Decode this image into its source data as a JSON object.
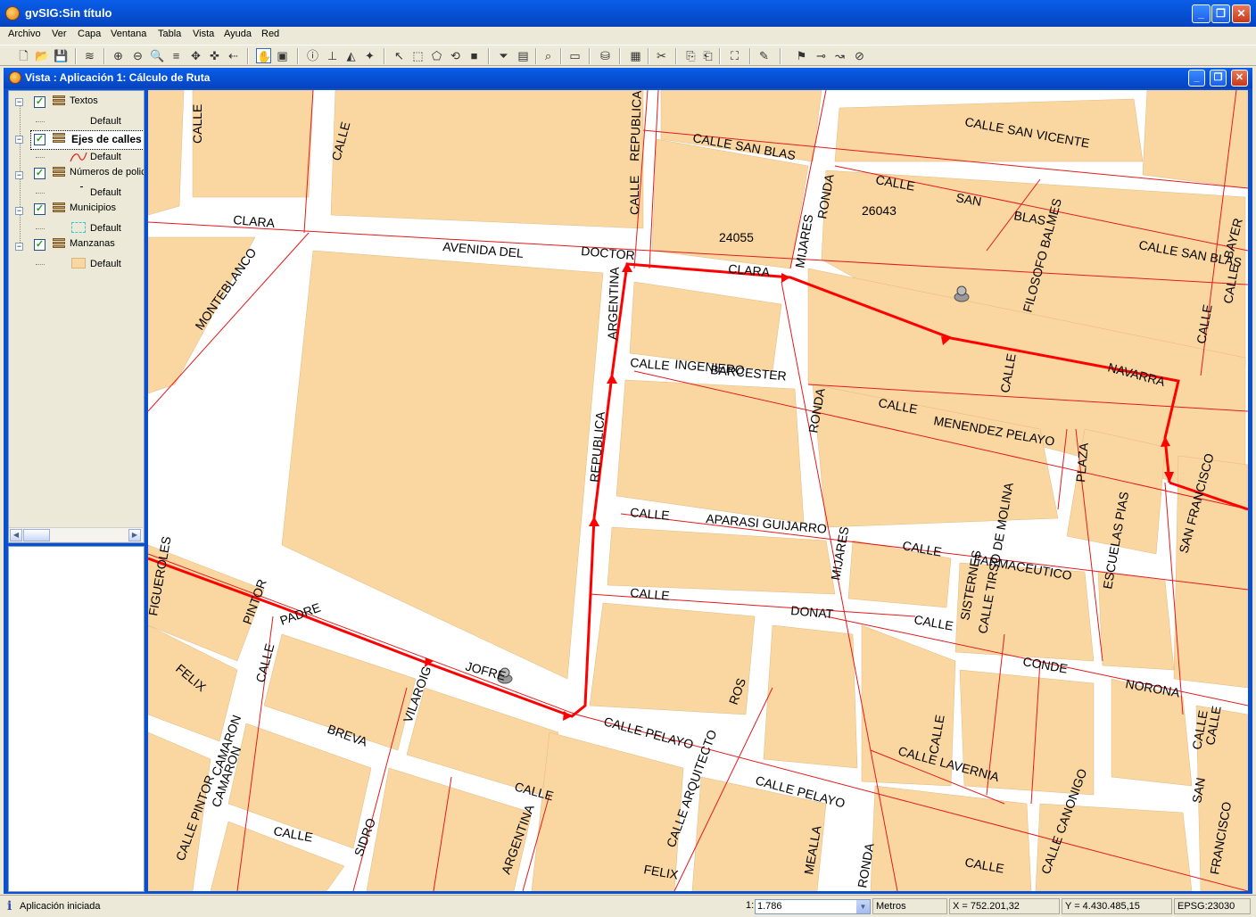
{
  "window": {
    "title": "gvSIG:Sin título"
  },
  "menu": [
    "Archivo",
    "Ver",
    "Capa",
    "Ventana",
    "Tabla",
    "Vista",
    "Ayuda",
    "Red"
  ],
  "view_window": {
    "title": "Vista : Aplicación 1: Cálculo de Ruta"
  },
  "toc": {
    "layers": [
      {
        "name": "Textos",
        "legend": "Default"
      },
      {
        "name": "Ejes de calles",
        "legend": "Default"
      },
      {
        "name": "Números de polici",
        "legend": "Default"
      },
      {
        "name": "Municipios",
        "legend": "Default"
      },
      {
        "name": "Manzanas",
        "legend": "Default"
      }
    ]
  },
  "map": {
    "colors": {
      "block": "#fad7a0",
      "street_axis": "#e31a1c",
      "route": "#ff0000",
      "street": "#ffffff"
    },
    "street_labels": [
      "CALLE",
      "CALLE",
      "CLARA",
      "AVENIDA DEL",
      "DOCTOR",
      "CLARA",
      "MONTEBLANCO",
      "ARGENTINA",
      "REPUBLICA",
      "CALLE",
      "REPUBLICA",
      "CALLE SAN BLAS",
      "RONDA",
      "MIJARES",
      "CALLE",
      "SAN",
      "BLAS",
      "CALLE SAN BLAS",
      "CALLE SAN VICENTE",
      "CALLE",
      "FILOSOFO BALMES",
      "NAVARRA",
      "CALLE",
      "CALLE",
      "BAYER",
      "CALLE",
      "INGENIERO",
      "BARCESTER",
      "CALLE",
      "MENENDEZ PELAYO",
      "RONDA",
      "PLAZA",
      "ESCUELAS PIAS",
      "CALLE",
      "APARASI GUIJARRO",
      "CALLE",
      "FARMACEUTICO",
      "CALLE",
      "DONAT",
      "MIJARES",
      "CALLE",
      "CONDE",
      "SISTERNES",
      "CALLE TIRSO DE MOLINA",
      "CALLE",
      "NORONA",
      "SAN FRANCISCO",
      "CALLE",
      "FIGUEROLES",
      "PADRE",
      "JOFRE",
      "CALLE",
      "PINTOR",
      "CAMARON",
      "FELIX",
      "BREVA",
      "VILAROIG",
      "CALLE PELAYO",
      "CALLE ARQUITECTO",
      "ROS",
      "CALLE PELAYO",
      "RONDA",
      "CALLE LAVERNIA",
      "CALLE CANONIGO",
      "SIDRO",
      "ARGENTINA",
      "CALLE",
      "FELIX",
      "MEALLA",
      "CALLE",
      "CALLE PINTOR",
      "CAMARON",
      "CALLE",
      "CALLE",
      "SAN",
      "FRANCISCO"
    ],
    "block_numbers": [
      "24055",
      "26043"
    ]
  },
  "status": {
    "message": "Aplicación iniciada",
    "scale_prefix": "1:",
    "scale_value": "1.786",
    "units": "Metros",
    "x": "X = 752.201,32",
    "y": "Y = 4.430.485,15",
    "epsg": "EPSG:23030"
  }
}
